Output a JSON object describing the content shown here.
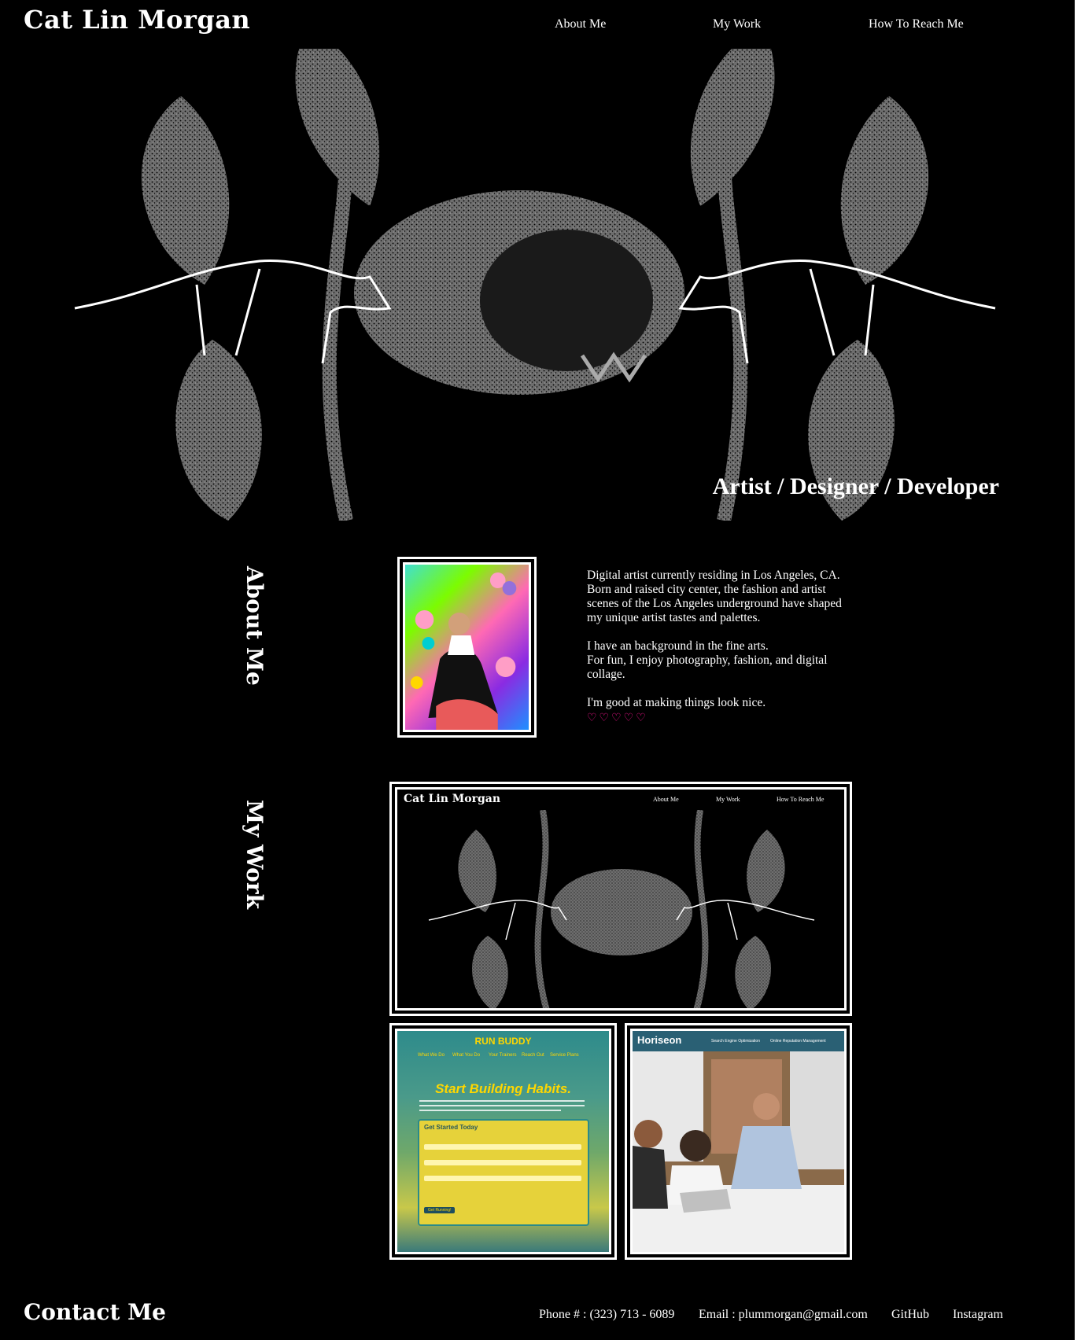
{
  "header": {
    "title": "Cat Lin Morgan",
    "nav": [
      "About Me",
      "My Work",
      "How To Reach Me"
    ]
  },
  "hero": {
    "tagline": "Artist / Designer / Developer"
  },
  "about": {
    "heading": "About Me",
    "paragraphs": [
      "Digital artist currently residing in Los Angeles, CA. Born and raised city center, the fashion and artist scenes of the Los Angeles underground have shaped my unique artist tastes and palettes.",
      "I have an background in the fine arts.",
      "For fun, I enjoy photography, fashion, and digital collage.",
      "I'm good at making things look nice."
    ],
    "hearts": "♡♡♡♡♡"
  },
  "work": {
    "heading": "My Work",
    "portfolio_preview": {
      "title": "Cat Lin Morgan",
      "nav": [
        "About Me",
        "My Work",
        "How To Reach Me"
      ]
    },
    "run_buddy": {
      "brand": "RUN BUDDY",
      "nav": [
        "What We Do",
        "What You Do",
        "Your Trainers",
        "Reach Out",
        "Service Plans"
      ],
      "headline": "Start Building Habits.",
      "form_title": "Get Started Today",
      "button": "Get Running!"
    },
    "horiseon": {
      "brand": "Horiseon",
      "nav": [
        "Search Engine Optimization",
        "Online Reputation Management"
      ]
    }
  },
  "footer": {
    "heading": "Contact Me",
    "phone": "Phone # : (323) 713 - 6089",
    "email": "Email : plummorgan@gmail.com",
    "github": "GitHub",
    "instagram": "Instagram"
  },
  "colors": {
    "background": "#000000",
    "text": "#ffffff",
    "hearts": "#ff1493",
    "art_gray": "#8a8a8a"
  }
}
